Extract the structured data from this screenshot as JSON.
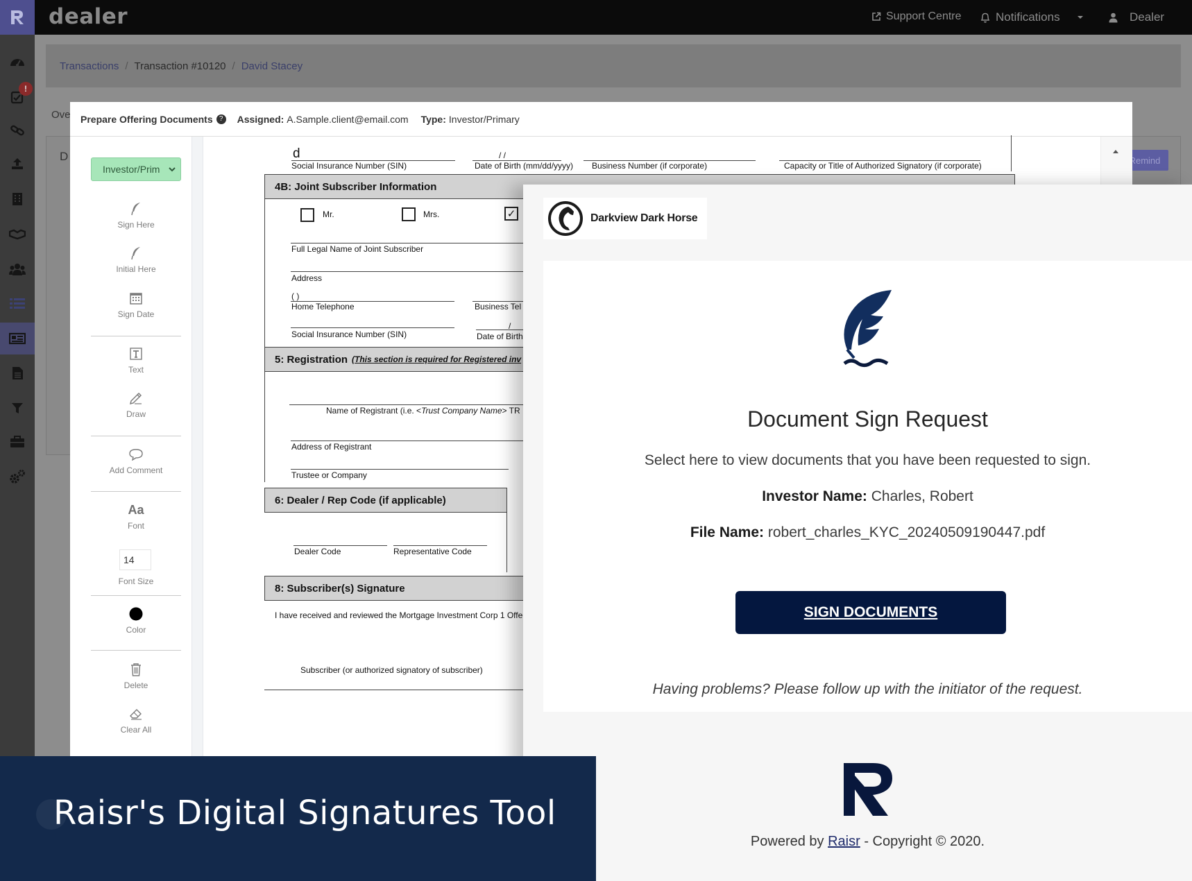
{
  "app": {
    "brand": "dealer",
    "support_label": "Support Centre",
    "notifications_label": "Notifications",
    "user_label": "Dealer",
    "nav_badge": "!"
  },
  "breadcrumb": [
    "Transactions",
    "Transaction #10120",
    "David Stacey"
  ],
  "background": {
    "tab_label": "Ove",
    "panel_title": "D",
    "remind_label": "Remind"
  },
  "modal": {
    "title": "Prepare Offering Documents",
    "assigned_label": "Assigned:",
    "assigned_value": "A.Sample.client@email.com",
    "type_label": "Type:",
    "type_value": "Investor/Primary"
  },
  "toolbox": {
    "role_select": "Investor/Prim",
    "tools": {
      "sign_here": "Sign Here",
      "initial_here": "Initial Here",
      "sign_date": "Sign Date",
      "text": "Text",
      "draw": "Draw",
      "add_comment": "Add Comment",
      "font_icon": "Aa",
      "font": "Font",
      "font_size_value": "14",
      "font_size": "Font Size",
      "color": "Color",
      "delete": "Delete",
      "clear_all": "Clear All"
    }
  },
  "form": {
    "top_value": "d",
    "top_row": [
      "Social Insurance Number (SIN)",
      "Date of Birth (mm/dd/yyyy)",
      "Business Number (if corporate)",
      "Capacity or Title of Authorized Signatory (if corporate)"
    ],
    "date_slashes": "/       /",
    "s4b_title": "4B: Joint Subscriber Information",
    "mr": "Mr.",
    "mrs": "Mrs.",
    "check_mark": "✓",
    "full_legal_name": "Full Legal Name of Joint Subscriber",
    "address": "Address",
    "home_phone_blank": "(          )",
    "home_phone": "Home Telephone",
    "business_phone": "Business Tel",
    "sin": "Social Insurance Number (SIN)",
    "dob": "Date of Birth",
    "dob_slash": "/",
    "s5_title": "5: Registration",
    "s5_note": "(This section is required for Registered inv",
    "registrant_name_prefix": "Name of Registrant (i.e. <",
    "registrant_name_italic": "Trust Company Name",
    "registrant_name_suffix": "> TR",
    "registrant_address": "Address of Registrant",
    "trustee": "Trustee or Company",
    "s6_title": "6: Dealer / Rep Code (if applicable)",
    "dealer_code": "Dealer Code",
    "rep_code": "Representative Code",
    "s8_title": "8: Subscriber(s) Signature",
    "s8_text": "I have received and reviewed the Mortgage Investment Corp 1 Offe",
    "subscriber_sig": "Subscriber (or authorized signatory of subscriber)"
  },
  "email": {
    "company_name": "Darkview Dark Horse",
    "title": "Document Sign Request",
    "subtitle": "Select here to view documents that you have been requested to sign.",
    "investor_label": "Investor Name:",
    "investor_value": "Charles, Robert",
    "file_label": "File Name:",
    "file_value": "robert_charles_KYC_20240509190447.pdf",
    "button_label": "SIGN DOCUMENTS",
    "help_text": "Having problems? Please follow up with the initiator of the request.",
    "powered_prefix": "Powered by",
    "powered_link": "Raisr",
    "powered_suffix": "- Copyright © 2020."
  },
  "banner": {
    "title": "Raisr's Digital Signatures Tool"
  },
  "colors": {
    "nav_bg": "#3b3b3b",
    "accent": "#4e4f8f",
    "sign_button": "#04173f",
    "banner": "#13294b",
    "role_select": "#a7e6b9"
  }
}
